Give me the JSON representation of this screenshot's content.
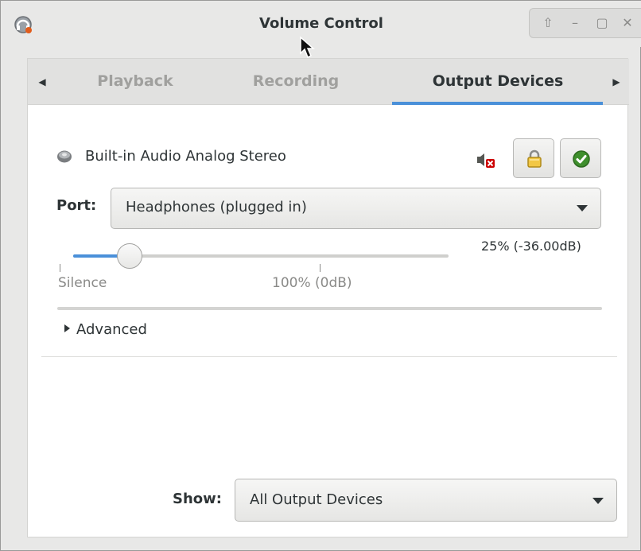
{
  "window": {
    "title": "Volume Control",
    "app_icon": "pavucontrol-headphones-icon",
    "buttons": [
      "pin-icon",
      "minimize-icon",
      "maximize-icon",
      "close-icon"
    ]
  },
  "tabs": {
    "items": [
      {
        "label": "Playback",
        "active": false
      },
      {
        "label": "Recording",
        "active": false
      },
      {
        "label": "Output Devices",
        "active": true
      }
    ],
    "scroll_left_icon": "triangle-left-icon",
    "scroll_right_icon": "triangle-right-icon",
    "accent": "#4a90d9"
  },
  "device": {
    "name": "Built-in Audio Analog Stereo",
    "icon": "speaker-icon",
    "mute_icon": "muted-speaker-icon",
    "lock_icon": "lock-icon",
    "default_icon": "checkmark-circle-icon",
    "port_label": "Port:",
    "port_value": "Headphones (plugged in)",
    "volume": {
      "value_text": "25% (-36.00dB)",
      "level_fraction": 0.25,
      "tick_silence": "Silence",
      "tick_100": "100% (0dB)"
    },
    "advanced_label": "Advanced"
  },
  "footer": {
    "show_label": "Show:",
    "show_value": "All Output Devices"
  }
}
